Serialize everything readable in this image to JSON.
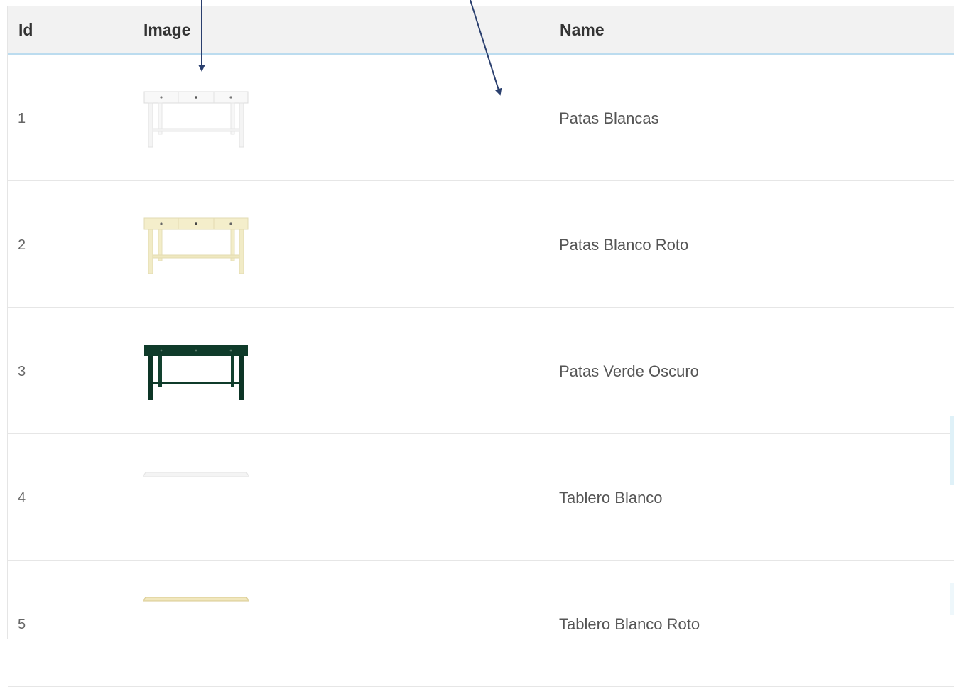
{
  "table": {
    "headers": [
      "Id",
      "Image",
      "Name"
    ],
    "rows": [
      {
        "id": "1",
        "name": "Patas Blancas",
        "image": "white-console-table"
      },
      {
        "id": "2",
        "name": "Patas Blanco Roto",
        "image": "cream-console-table"
      },
      {
        "id": "3",
        "name": "Patas Verde Oscuro",
        "image": "dark-green-console-table"
      },
      {
        "id": "4",
        "name": "Tablero Blanco",
        "image": "white-table-top"
      },
      {
        "id": "5",
        "name": "Tablero Blanco Roto",
        "image": "cream-table-top"
      }
    ]
  },
  "colors": {
    "header_bg": "#f2f2f2",
    "header_border": "#bcdcef",
    "arrow": "#2a3f6e",
    "white_table": "#f7f7f7",
    "cream_table": "#f3edc8",
    "green_table": "#0f3b2a"
  }
}
